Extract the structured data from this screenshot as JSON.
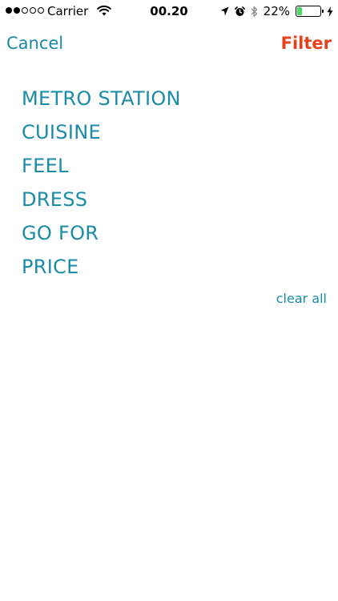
{
  "status_bar": {
    "signal_bars_filled": 2,
    "signal_bars_total": 5,
    "carrier": "Carrier",
    "time": "00.20",
    "battery_percent": "22%",
    "battery_level": 0.22,
    "icons": [
      "wifi-icon",
      "location-arrow-icon",
      "alarm-icon",
      "bluetooth-icon",
      "battery-icon",
      "charging-bolt-icon"
    ]
  },
  "nav": {
    "cancel_label": "Cancel",
    "filter_label": "Filter"
  },
  "filters": [
    {
      "label": "METRO STATION"
    },
    {
      "label": "CUISINE"
    },
    {
      "label": "FEEL"
    },
    {
      "label": "DRESS"
    },
    {
      "label": "GO FOR"
    },
    {
      "label": "PRICE"
    }
  ],
  "clear_all_label": "clear all",
  "colors": {
    "accent": "#1a8ba8",
    "filter_action": "#e8401c",
    "battery_fill": "#4cd964"
  }
}
